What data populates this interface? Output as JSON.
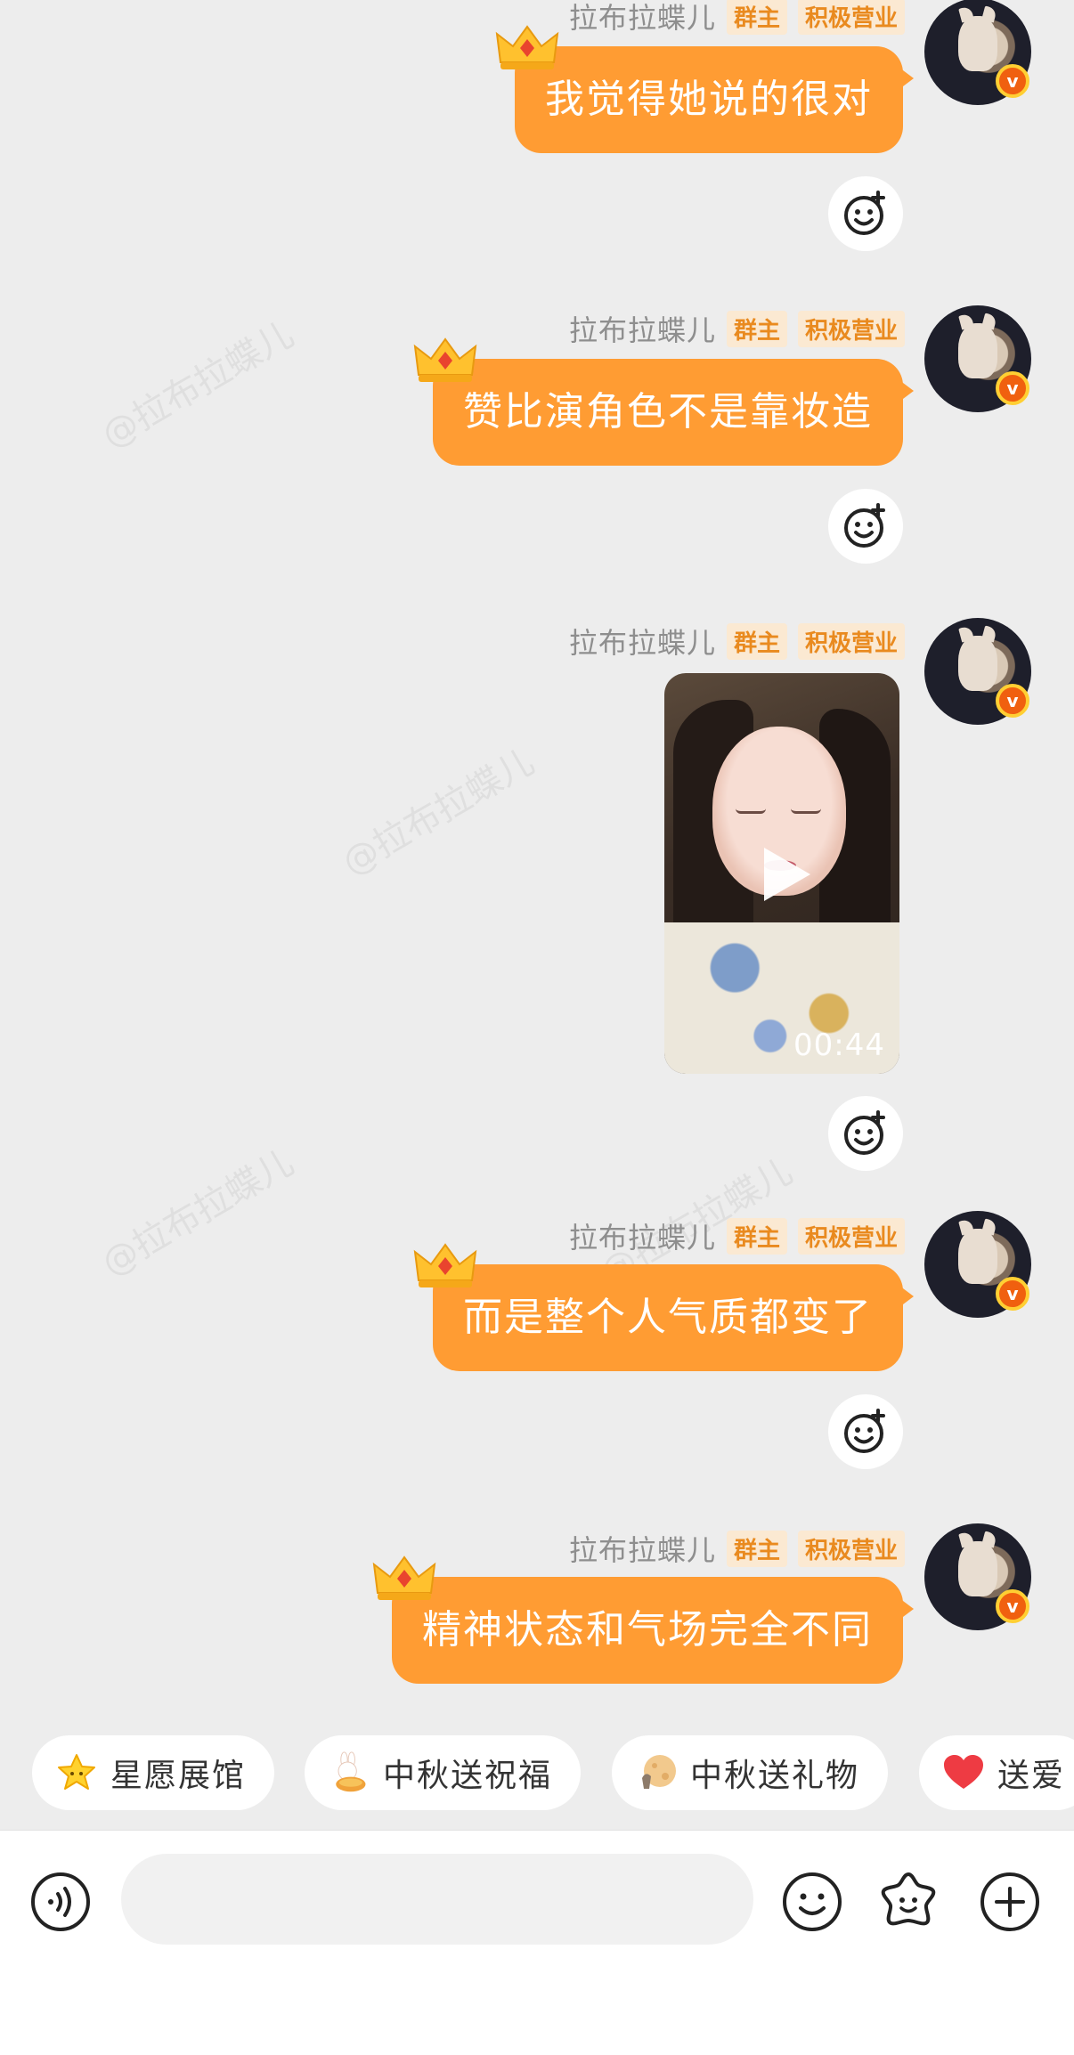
{
  "watermark": "@拉布拉蝶儿",
  "messages": [
    {
      "sender": "拉布拉蝶儿",
      "tags": [
        "群主",
        "积极营业"
      ],
      "type": "text",
      "text": "我觉得她说的很对"
    },
    {
      "sender": "拉布拉蝶儿",
      "tags": [
        "群主",
        "积极营业"
      ],
      "type": "text",
      "text": "赞比演角色不是靠妆造"
    },
    {
      "sender": "拉布拉蝶儿",
      "tags": [
        "群主",
        "积极营业"
      ],
      "type": "video",
      "duration": "00:44"
    },
    {
      "sender": "拉布拉蝶儿",
      "tags": [
        "群主",
        "积极营业"
      ],
      "type": "text",
      "text": "而是整个人气质都变了"
    },
    {
      "sender": "拉布拉蝶儿",
      "tags": [
        "群主",
        "积极营业"
      ],
      "type": "text",
      "text": "精神状态和气场完全不同"
    }
  ],
  "quick_actions": [
    {
      "label": "星愿展馆",
      "icon": "star-icon"
    },
    {
      "label": "中秋送祝福",
      "icon": "rabbit-mooncake-icon"
    },
    {
      "label": "中秋送礼物",
      "icon": "moon-gift-icon"
    },
    {
      "label": "送爱",
      "icon": "heart-icon"
    }
  ],
  "input_bar": {
    "placeholder": "",
    "icons": [
      "voice-icon",
      "emoji-icon",
      "sticker-icon",
      "plus-icon"
    ]
  },
  "colors": {
    "bubble": "#ff9c33",
    "background": "#ededed",
    "tag_bg": "#fbe9d2",
    "tag_text": "#e98a1f"
  }
}
